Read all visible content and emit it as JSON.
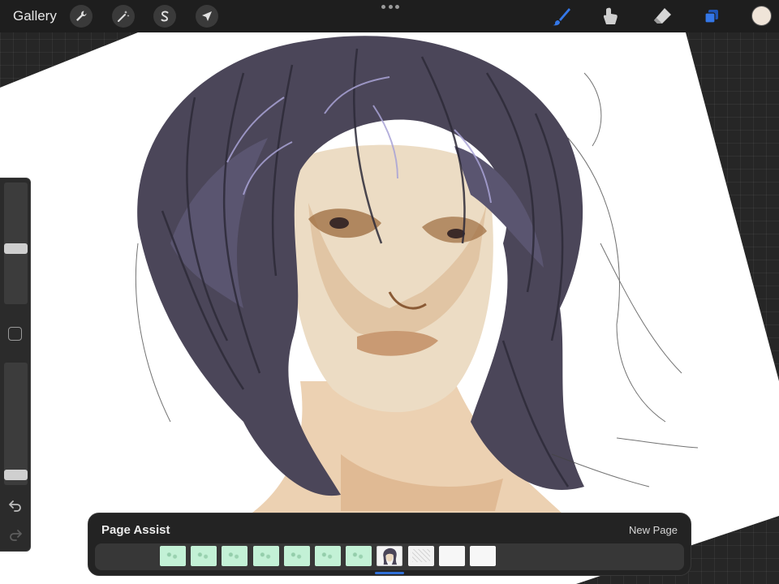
{
  "topbar": {
    "gallery_label": "Gallery",
    "left_tools": [
      {
        "name": "actions",
        "icon": "wrench-icon"
      },
      {
        "name": "adjustments",
        "icon": "magic-wand-icon"
      },
      {
        "name": "selection",
        "icon": "selection-s-icon"
      },
      {
        "name": "transform",
        "icon": "arrow-cursor-icon"
      }
    ],
    "more_icon": "more-dots-icon",
    "right_tools": [
      {
        "name": "brush",
        "icon": "brush-icon",
        "active": true
      },
      {
        "name": "smudge",
        "icon": "smudge-icon",
        "active": false
      },
      {
        "name": "eraser",
        "icon": "eraser-icon",
        "active": false
      },
      {
        "name": "layers",
        "icon": "layers-icon",
        "active": true
      }
    ],
    "current_color": "#efe4d8",
    "accent_color": "#3477e8"
  },
  "sidebar": {
    "brush_size_level": 0.45,
    "opacity_level": 0.04,
    "modify_icon": "square-modify-icon",
    "undo_icon": "undo-icon",
    "redo_icon": "redo-icon"
  },
  "page_assist": {
    "title": "Page Assist",
    "new_page_label": "New Page",
    "pages": [
      {
        "style": "green"
      },
      {
        "style": "green"
      },
      {
        "style": "green"
      },
      {
        "style": "green"
      },
      {
        "style": "green"
      },
      {
        "style": "green"
      },
      {
        "style": "green"
      },
      {
        "style": "portrait",
        "selected": true
      },
      {
        "style": "sketch"
      },
      {
        "style": "white"
      },
      {
        "style": "white"
      }
    ]
  }
}
